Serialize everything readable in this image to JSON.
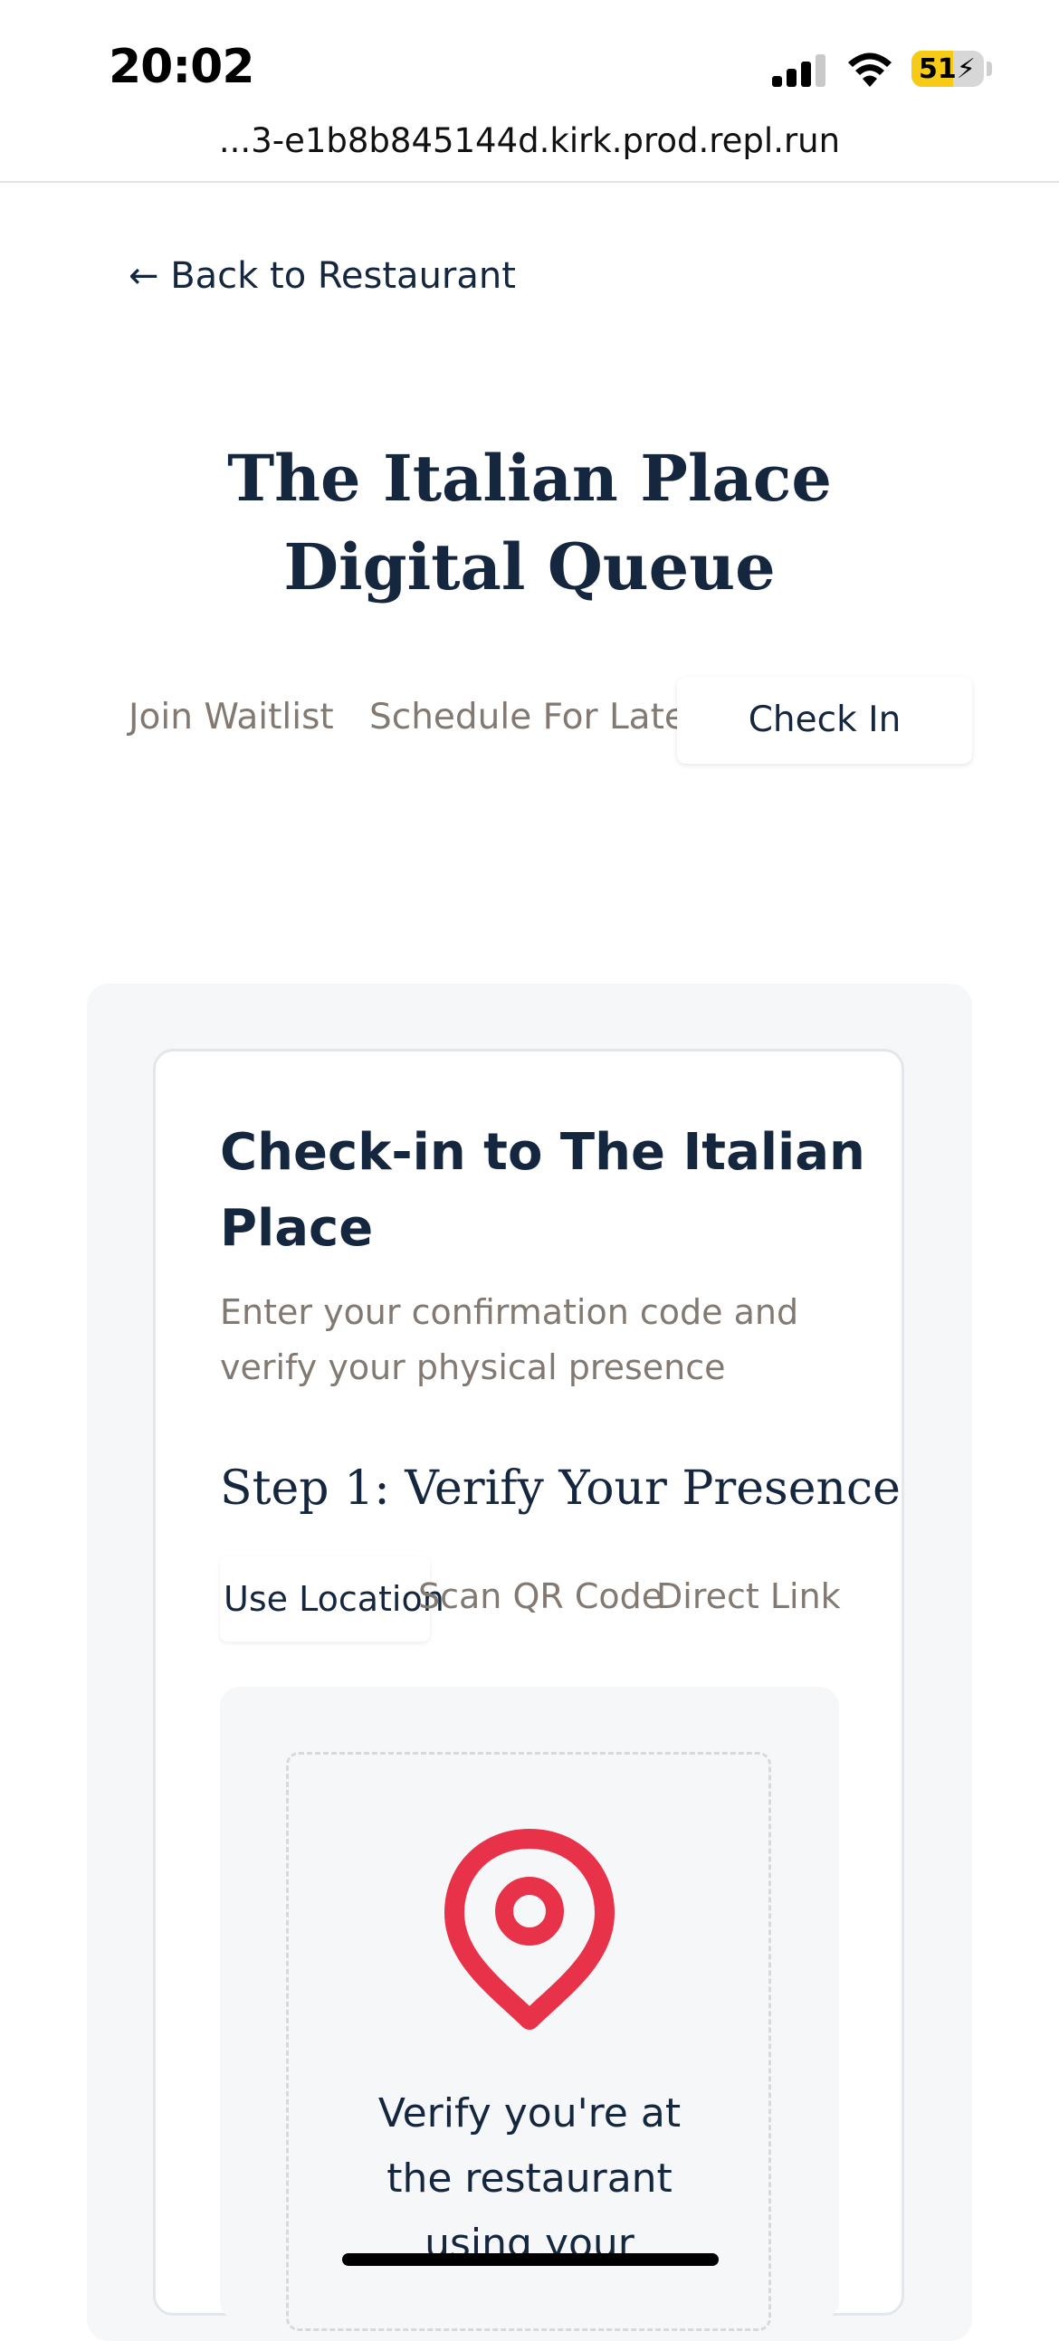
{
  "status_bar": {
    "time": "20:02",
    "battery": "51",
    "battery_color": "#f7ca15"
  },
  "browser": {
    "url": "...3-e1b8b845144d.kirk.prod.repl.run"
  },
  "page": {
    "back_link": "← Back to Restaurant",
    "title": "The Italian Place Digital Queue",
    "tabs": [
      {
        "label": "Join Waitlist",
        "active": false
      },
      {
        "label": "Schedule For Later",
        "active": false
      },
      {
        "label": "Check In",
        "active": true
      }
    ]
  },
  "checkin_card": {
    "title": "Check-in to The Italian Place",
    "description": "Enter your confirmation code and verify your physical presence",
    "step_title": "Step 1: Verify Your Presence",
    "method_tabs": [
      {
        "label": "Use Location",
        "active": true
      },
      {
        "label": "Scan QR Code",
        "active": false
      },
      {
        "label": "Direct Link",
        "active": false
      }
    ],
    "location_icon": "map-pin-icon",
    "icon_color": "#e8324a",
    "verify_text": "Verify you're at the restaurant using your"
  }
}
